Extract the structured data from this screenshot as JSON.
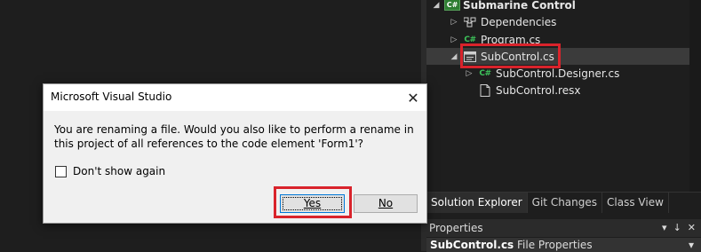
{
  "solution_explorer": {
    "items": [
      {
        "label": "Submarine Control",
        "icon": "csharp-project-icon",
        "expander": "expanded"
      },
      {
        "label": "Dependencies",
        "icon": "dependencies-icon",
        "expander": "collapsed"
      },
      {
        "label": "Program.cs",
        "icon": "csharp-file-icon",
        "expander": "collapsed"
      },
      {
        "label": "SubControl.cs",
        "icon": "form-file-icon",
        "expander": "expanded",
        "selected": true,
        "highlighted": true
      },
      {
        "label": "SubControl.Designer.cs",
        "icon": "csharp-file-icon",
        "expander": "collapsed"
      },
      {
        "label": "SubControl.resx",
        "icon": "resource-file-icon",
        "expander": "none"
      }
    ],
    "cs_badge": "C#"
  },
  "tabs": [
    {
      "label": "Solution Explorer",
      "active": true
    },
    {
      "label": "Git Changes",
      "active": false
    },
    {
      "label": "Class View",
      "active": false
    }
  ],
  "properties": {
    "title": "Properties",
    "pin_glyph": "▾",
    "pushpin_glyph": "↓",
    "close_glyph": "✕",
    "object_name": "SubControl.cs",
    "object_type": "File Properties",
    "dropdown_glyph": "▾"
  },
  "dialog": {
    "title": "Microsoft Visual Studio",
    "close_glyph": "✕",
    "message": "You are renaming a file. Would you also like to perform a rename in this project of all references to the code element 'Form1'?",
    "checkbox_label": "Don't show again",
    "checkbox_checked": false,
    "yes_label": "Yes",
    "no_label": "No",
    "highlighted_button": "Yes"
  },
  "colors": {
    "highlight_box": "#d9232b",
    "csharp_green": "#3dc35a"
  }
}
